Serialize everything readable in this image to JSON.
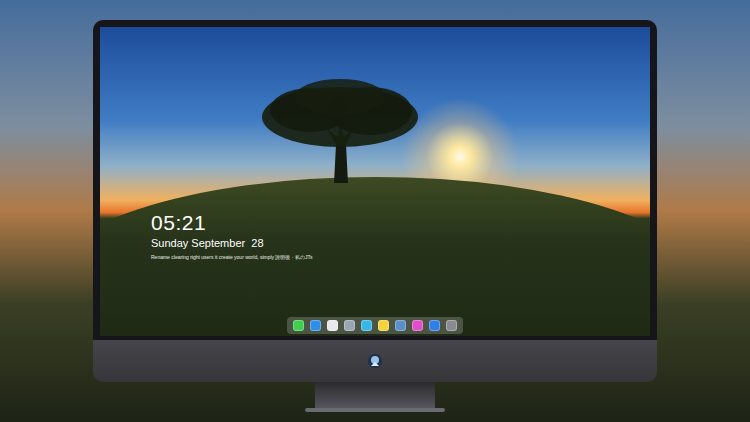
{
  "lock_screen": {
    "time": "05:21",
    "date": "Sunday September  28",
    "tagline": "Rename clearing right users it create your world, simply 說明後 · 私のJTs"
  },
  "dock": {
    "items": [
      {
        "name": "messages",
        "color": "#3ecf4f"
      },
      {
        "name": "finder",
        "color": "#2f8fe8"
      },
      {
        "name": "safari",
        "color": "#e8e8ea"
      },
      {
        "name": "preview",
        "color": "#9aa6b4"
      },
      {
        "name": "movies",
        "color": "#38b6e8"
      },
      {
        "name": "notes",
        "color": "#f4d23c"
      },
      {
        "name": "photos",
        "color": "#5a8fc8"
      },
      {
        "name": "music",
        "color": "#e04ec8"
      },
      {
        "name": "app-store",
        "color": "#2f7fe8"
      },
      {
        "name": "camera",
        "color": "#8a8a90"
      }
    ]
  }
}
